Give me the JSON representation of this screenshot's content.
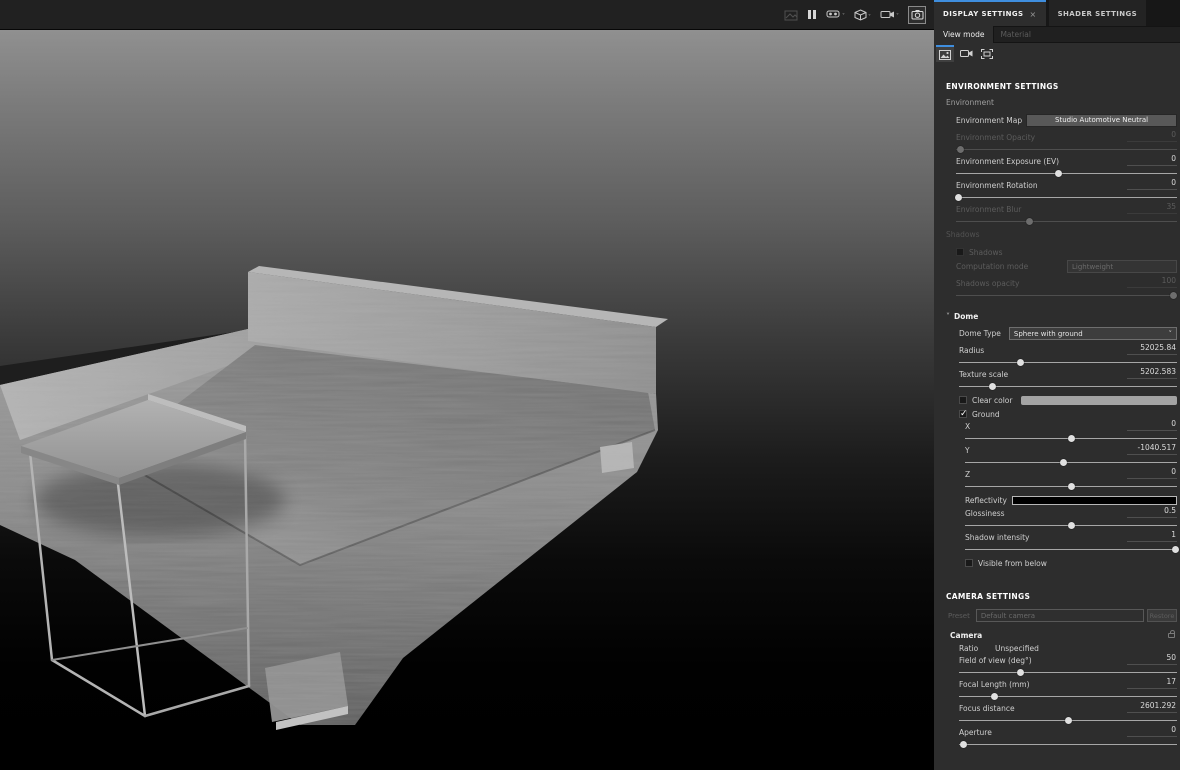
{
  "viewport": {
    "toolbar_icons": [
      {
        "name": "snapshot-disabled-icon",
        "disabled": true
      },
      {
        "name": "pause-icon"
      },
      {
        "name": "vr-headset-icon",
        "has_dropdown": true
      },
      {
        "name": "geometry-icon",
        "has_dropdown": true
      },
      {
        "name": "camera-video-icon",
        "has_dropdown": true
      },
      {
        "name": "camera-photo-icon",
        "active": true
      }
    ]
  },
  "panel": {
    "accent_color": "#3f8ede",
    "tabs": [
      {
        "label": "DISPLAY SETTINGS",
        "close": "×",
        "active": true
      },
      {
        "label": "SHADER SETTINGS",
        "active": false
      }
    ],
    "subtabs": [
      {
        "label": "View mode",
        "active": true
      },
      {
        "label": "Material",
        "active": false
      }
    ],
    "view_icons": [
      "image-view-icon",
      "camera-view-icon",
      "frame-view-icon"
    ],
    "sections": [
      {
        "type": "header",
        "label": "ENVIRONMENT SETTINGS"
      },
      {
        "type": "group",
        "label": "Environment"
      },
      {
        "type": "mapbtn",
        "label": "Environment Map",
        "value": "Studio Automotive Neutral"
      },
      {
        "type": "slider",
        "label": "Environment Opacity",
        "value": "0",
        "pos": 0.02,
        "dim": true
      },
      {
        "type": "slider",
        "label": "Environment Exposure (EV)",
        "value": "0",
        "pos": 0.46
      },
      {
        "type": "slider",
        "label": "Environment Rotation",
        "value": "0",
        "pos": 0.01
      },
      {
        "type": "slider",
        "label": "Environment Blur",
        "value": "35",
        "pos": 0.33,
        "dim": true
      },
      {
        "type": "group",
        "label": "Shadows",
        "dim": true
      },
      {
        "type": "checkbox",
        "label": "Shadows",
        "checked": false,
        "dim": true
      },
      {
        "type": "dropdown",
        "label": "Computation mode",
        "value": "Lightweight",
        "dim": true
      },
      {
        "type": "slider",
        "label": "Shadows opacity",
        "value": "100",
        "pos": 0.98,
        "dim": true
      },
      {
        "type": "toggle",
        "label": "Dome",
        "expanded": true
      },
      {
        "type": "dropdown",
        "label": "Dome Type",
        "value": "Sphere with ground",
        "chevron": "˅",
        "indent": 1
      },
      {
        "type": "slider",
        "label": "Radius",
        "value": "52025.84",
        "pos": 0.28,
        "indent": 1
      },
      {
        "type": "slider",
        "label": "Texture scale",
        "value": "5202.583",
        "pos": 0.15,
        "indent": 1
      },
      {
        "type": "checkbox",
        "label": "Clear color",
        "checked": false,
        "swatch": "#a3a3a3",
        "indent": 1
      },
      {
        "type": "checkbox",
        "label": "Ground",
        "checked": true,
        "indent": 1
      },
      {
        "type": "slider",
        "label": "X",
        "value": "0",
        "pos": 0.5,
        "indent": 2
      },
      {
        "type": "slider",
        "label": "Y",
        "value": "-1040.517",
        "pos": 0.46,
        "indent": 2
      },
      {
        "type": "slider",
        "label": "Z",
        "value": "0",
        "pos": 0.5,
        "indent": 2
      },
      {
        "type": "swatch",
        "label": "Reflectivity",
        "swatch": "#000000",
        "indent": 2
      },
      {
        "type": "slider",
        "label": "Glossiness",
        "value": "0.5",
        "pos": 0.5,
        "indent": 2
      },
      {
        "type": "slider",
        "label": "Shadow intensity",
        "value": "1",
        "pos": 0.99,
        "indent": 2
      },
      {
        "type": "checkbox",
        "label": "Visible from below",
        "checked": false,
        "indent": 2
      },
      {
        "type": "header",
        "label": "CAMERA SETTINGS"
      },
      {
        "type": "preset",
        "label": "Preset",
        "value": "Default camera",
        "button": "Restore",
        "dim": true
      },
      {
        "type": "subsection",
        "label": "Camera",
        "lock": true
      },
      {
        "type": "static",
        "label": "Ratio",
        "value": "Unspecified",
        "indent": 1
      },
      {
        "type": "slider",
        "label": "Field of view (deg°)",
        "value": "50",
        "pos": 0.28,
        "indent": 1
      },
      {
        "type": "slider",
        "label": "Focal Length (mm)",
        "value": "17",
        "pos": 0.16,
        "indent": 1
      },
      {
        "type": "slider",
        "label": "Focus distance",
        "value": "2601.292",
        "pos": 0.5,
        "indent": 1
      },
      {
        "type": "slider",
        "label": "Aperture",
        "value": "0",
        "pos": 0.02,
        "indent": 1
      }
    ]
  }
}
